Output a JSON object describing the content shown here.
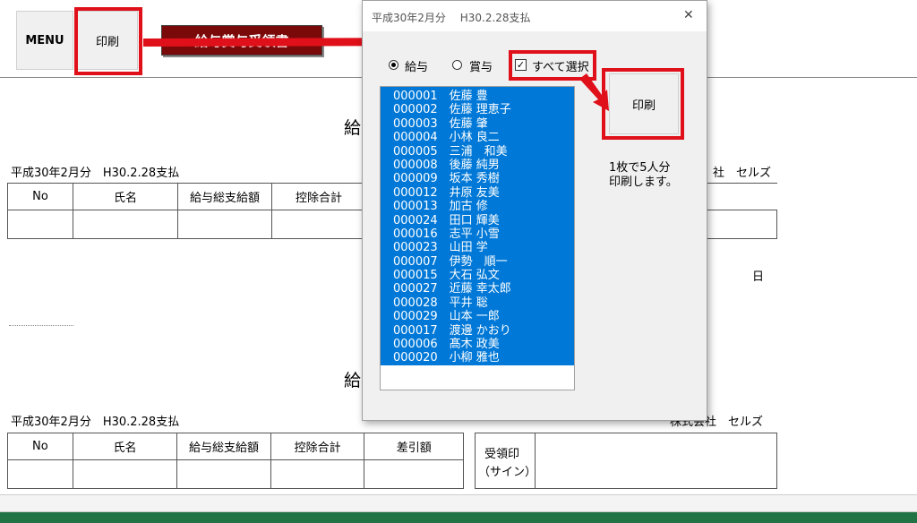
{
  "toolbar": {
    "menu_label": "MENU",
    "print_label": "印刷",
    "banner_label": "給与賞与受領書"
  },
  "sheet": {
    "heading_char": "給",
    "period": "平成30年2月分　H30.2.28支払",
    "company": "株式会社　セルズ",
    "company_partial": "社　セルズ",
    "day_char": "日",
    "columns": [
      "No",
      "氏名",
      "給与総支給額",
      "控除合計",
      "差引額"
    ],
    "receipt_label_1": "受領印",
    "receipt_label_2": "（サイン）"
  },
  "dialog": {
    "title": "平成30年2月分　 H30.2.28支払",
    "close_glyph": "✕",
    "radio_salary": "給与",
    "radio_bonus": "賞与",
    "select_all": "すべて選択",
    "check_glyph": "✓",
    "print_button": "印刷",
    "note_line1": "1枚で5人分",
    "note_line2": "印刷します。",
    "employees": [
      "000001　佐藤 豊",
      "000002　佐藤 理恵子",
      "000003　佐藤 肇",
      "000004　小林 良二",
      "000005　三浦　和美",
      "000008　後藤 純男",
      "000009　坂本 秀樹",
      "000012　井原 友美",
      "000013　加古 修",
      "000024　田口 輝美",
      "000016　志平 小雪",
      "000023　山田 学",
      "000007　伊勢　順一",
      "000015　大石 弘文",
      "000027　近藤 幸太郎",
      "000028　平井 聡",
      "000029　山本 一郎",
      "000017　渡邊 かおり",
      "000006　髙木 政美",
      "000020　小柳 雅也"
    ]
  },
  "colors": {
    "selection": "#0078d7",
    "highlight_red": "#e0101a",
    "banner": "#7a0a0a",
    "excel_green": "#217346"
  }
}
